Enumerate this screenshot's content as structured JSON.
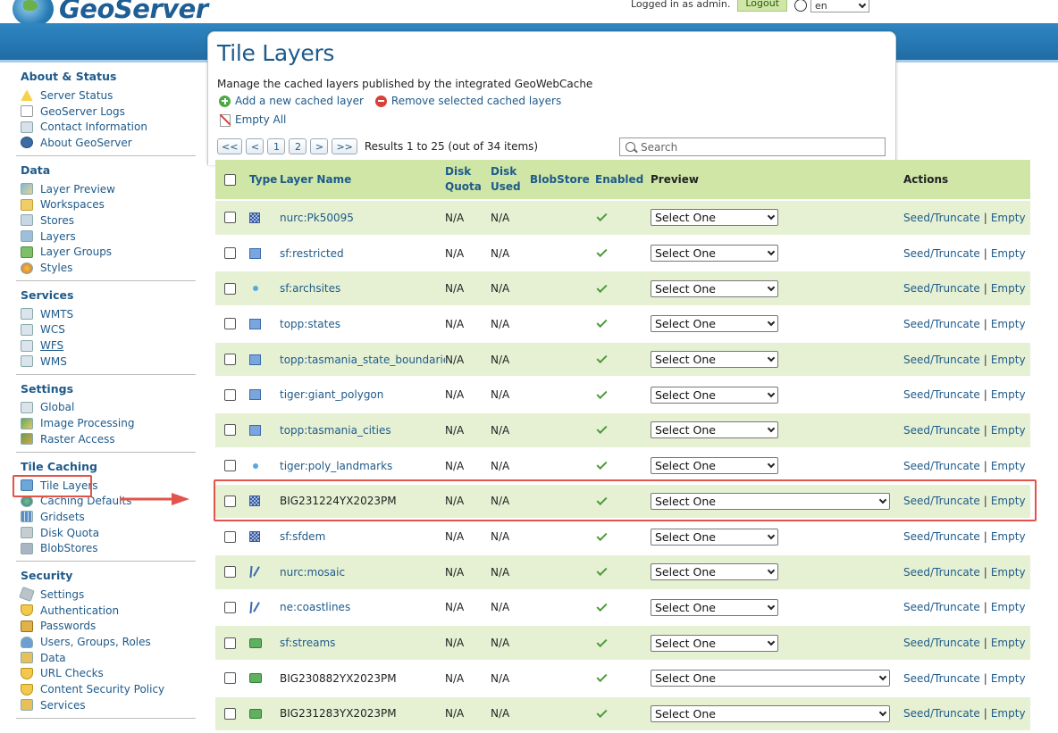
{
  "header": {
    "brand": "GeoServer",
    "login_text": "Logged in as admin.",
    "logout_label": "Logout",
    "language": "en"
  },
  "sidebar": {
    "sections": [
      {
        "heading": "About & Status",
        "items": [
          {
            "label": "Server Status",
            "icon": "warning-icon"
          },
          {
            "label": "GeoServer Logs",
            "icon": "document-icon"
          },
          {
            "label": "Contact Information",
            "icon": "contact-card-icon"
          },
          {
            "label": "About GeoServer",
            "icon": "info-icon"
          }
        ]
      },
      {
        "heading": "Data",
        "items": [
          {
            "label": "Layer Preview",
            "icon": "map-preview-icon"
          },
          {
            "label": "Workspaces",
            "icon": "folder-icon"
          },
          {
            "label": "Stores",
            "icon": "store-icon"
          },
          {
            "label": "Layers",
            "icon": "layers-icon"
          },
          {
            "label": "Layer Groups",
            "icon": "layer-group-icon"
          },
          {
            "label": "Styles",
            "icon": "palette-icon"
          }
        ]
      },
      {
        "heading": "Services",
        "items": [
          {
            "label": "WMTS",
            "icon": "service-icon"
          },
          {
            "label": "WCS",
            "icon": "service-icon"
          },
          {
            "label": "WFS",
            "icon": "service-icon"
          },
          {
            "label": "WMS",
            "icon": "service-icon"
          }
        ]
      },
      {
        "heading": "Settings",
        "items": [
          {
            "label": "Global",
            "icon": "global-settings-icon"
          },
          {
            "label": "Image Processing",
            "icon": "image-icon"
          },
          {
            "label": "Raster Access",
            "icon": "raster-icon"
          }
        ]
      },
      {
        "heading": "Tile Caching",
        "items": [
          {
            "label": "Tile Layers",
            "icon": "tile-layers-icon"
          },
          {
            "label": "Caching Defaults",
            "icon": "caching-globe-icon"
          },
          {
            "label": "Gridsets",
            "icon": "grid-icon"
          },
          {
            "label": "Disk Quota",
            "icon": "disk-icon"
          },
          {
            "label": "BlobStores",
            "icon": "blobstore-icon"
          }
        ]
      },
      {
        "heading": "Security",
        "items": [
          {
            "label": "Settings",
            "icon": "wrench-icon"
          },
          {
            "label": "Authentication",
            "icon": "shield-icon"
          },
          {
            "label": "Passwords",
            "icon": "lock-icon"
          },
          {
            "label": "Users, Groups, Roles",
            "icon": "users-icon"
          },
          {
            "label": "Data",
            "icon": "key-icon"
          },
          {
            "label": "URL Checks",
            "icon": "shield-icon"
          },
          {
            "label": "Content Security Policy",
            "icon": "shield-icon"
          },
          {
            "label": "Services",
            "icon": "key-icon"
          }
        ]
      }
    ]
  },
  "main": {
    "title": "Tile Layers",
    "description": "Manage the cached layers published by the integrated GeoWebCache",
    "add_link": "Add a new cached layer",
    "remove_link": "Remove selected cached layers",
    "empty_all": "Empty All",
    "pager": {
      "first": "<<",
      "prev": "<",
      "page1": "1",
      "page2": "2",
      "next": ">",
      "last": ">>",
      "summary": "Results 1 to 25 (out of 34 items)"
    },
    "search_placeholder": "Search"
  },
  "table": {
    "headers": {
      "type": "Type",
      "name": "Layer Name",
      "quota_1": "Disk",
      "quota_2": "Quota",
      "used_1": "Disk",
      "used_2": "Used",
      "blob": "BlobStore",
      "enabled": "Enabled",
      "preview": "Preview",
      "actions": "Actions"
    },
    "seed_label": "Seed/Truncate",
    "separator": "|",
    "empty_label": "Empty",
    "rows": [
      {
        "name": "nurc:Pk50095",
        "type": "raster",
        "quota": "N/A",
        "used": "N/A",
        "preview": "Select One"
      },
      {
        "name": "sf:restricted",
        "type": "polygon",
        "quota": "N/A",
        "used": "N/A",
        "preview": "Select One"
      },
      {
        "name": "sf:archsites",
        "type": "point",
        "quota": "N/A",
        "used": "N/A",
        "preview": "Select One"
      },
      {
        "name": "topp:states",
        "type": "polygon",
        "quota": "N/A",
        "used": "N/A",
        "preview": "Select One"
      },
      {
        "name": "topp:tasmania_state_boundaries",
        "type": "polygon",
        "quota": "N/A",
        "used": "N/A",
        "preview": "Select One"
      },
      {
        "name": "tiger:giant_polygon",
        "type": "polygon",
        "quota": "N/A",
        "used": "N/A",
        "preview": "Select One"
      },
      {
        "name": "topp:tasmania_cities",
        "type": "polygon",
        "quota": "N/A",
        "used": "N/A",
        "preview": "Select One"
      },
      {
        "name": "tiger:poly_landmarks",
        "type": "point",
        "quota": "N/A",
        "used": "N/A",
        "preview": "Select One"
      },
      {
        "name": "BIG231224YX2023PM",
        "type": "raster",
        "quota": "N/A",
        "used": "N/A",
        "preview": "Select One"
      },
      {
        "name": "sf:sfdem",
        "type": "raster",
        "quota": "N/A",
        "used": "N/A",
        "preview": "Select One"
      },
      {
        "name": "nurc:mosaic",
        "type": "line",
        "quota": "N/A",
        "used": "N/A",
        "preview": "Select One"
      },
      {
        "name": "ne:coastlines",
        "type": "line",
        "quota": "N/A",
        "used": "N/A",
        "preview": "Select One"
      },
      {
        "name": "sf:streams",
        "type": "group",
        "quota": "N/A",
        "used": "N/A",
        "preview": "Select One"
      },
      {
        "name": "BIG230882YX2023PM",
        "type": "group",
        "quota": "N/A",
        "used": "N/A",
        "preview": "Select One"
      },
      {
        "name": "BIG231283YX2023PM",
        "type": "group",
        "quota": "N/A",
        "used": "N/A",
        "preview": "Select One"
      }
    ]
  },
  "colors": {
    "accent_blue": "#1e5a8a",
    "header_band": "#2576b0",
    "table_header_bg": "#cfe6a7",
    "row_alt_bg": "#e6f1d4",
    "highlight_red": "#e2534a"
  }
}
